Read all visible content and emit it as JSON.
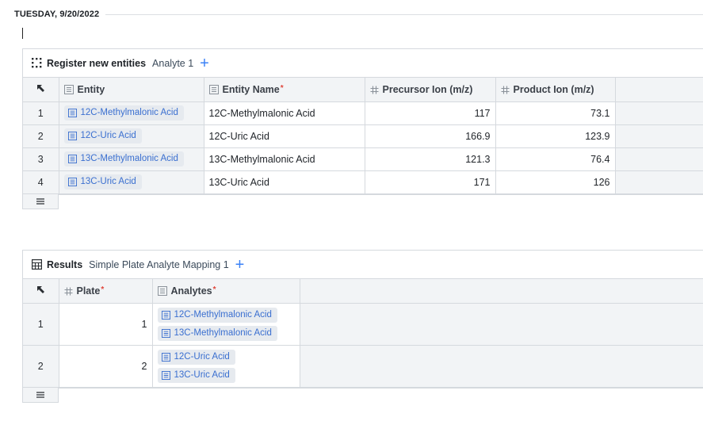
{
  "date_header": {
    "label": "TUESDAY, 9/20/2022"
  },
  "registration": {
    "title": "Register new entities",
    "tab_label": "Analyte 1",
    "add_symbol": "+",
    "columns": [
      {
        "label": "Entity",
        "icon": "entity-icon",
        "required": false
      },
      {
        "label": "Entity Name",
        "icon": "text-field-icon",
        "required": true
      },
      {
        "label": "Precursor Ion (m/z)",
        "icon": "hash-icon",
        "required": false
      },
      {
        "label": "Product Ion (m/z)",
        "icon": "hash-icon",
        "required": false
      }
    ],
    "required_mark": "*",
    "rows": [
      {
        "num": "1",
        "entity": "12C-Methylmalonic Acid",
        "name": "12C-Methylmalonic Acid",
        "precursor": "117",
        "product": "73.1"
      },
      {
        "num": "2",
        "entity": "12C-Uric Acid",
        "name": "12C-Uric Acid",
        "precursor": "166.9",
        "product": "123.9"
      },
      {
        "num": "3",
        "entity": "13C-Methylmalonic Acid",
        "name": "13C-Methylmalonic Acid",
        "precursor": "121.3",
        "product": "76.4"
      },
      {
        "num": "4",
        "entity": "13C-Uric Acid",
        "name": "13C-Uric Acid",
        "precursor": "171",
        "product": "126"
      }
    ]
  },
  "results": {
    "title": "Results",
    "tab_label": "Simple Plate Analyte Mapping 1",
    "add_symbol": "+",
    "columns": [
      {
        "label": "Plate",
        "icon": "hash-icon",
        "required": true
      },
      {
        "label": "Analytes",
        "icon": "entity-icon",
        "required": true
      }
    ],
    "required_mark": "*",
    "rows": [
      {
        "num": "1",
        "plate": "1",
        "analytes": [
          "12C-Methylmalonic Acid",
          "13C-Methylmalonic Acid"
        ]
      },
      {
        "num": "2",
        "plate": "2",
        "analytes": [
          "12C-Uric Acid",
          "13C-Uric Acid"
        ]
      }
    ]
  },
  "colors": {
    "chip_text": "#3a6fd0",
    "chip_bg": "#e6eaef",
    "accent": "#3b82f6",
    "required": "#e0453a"
  }
}
